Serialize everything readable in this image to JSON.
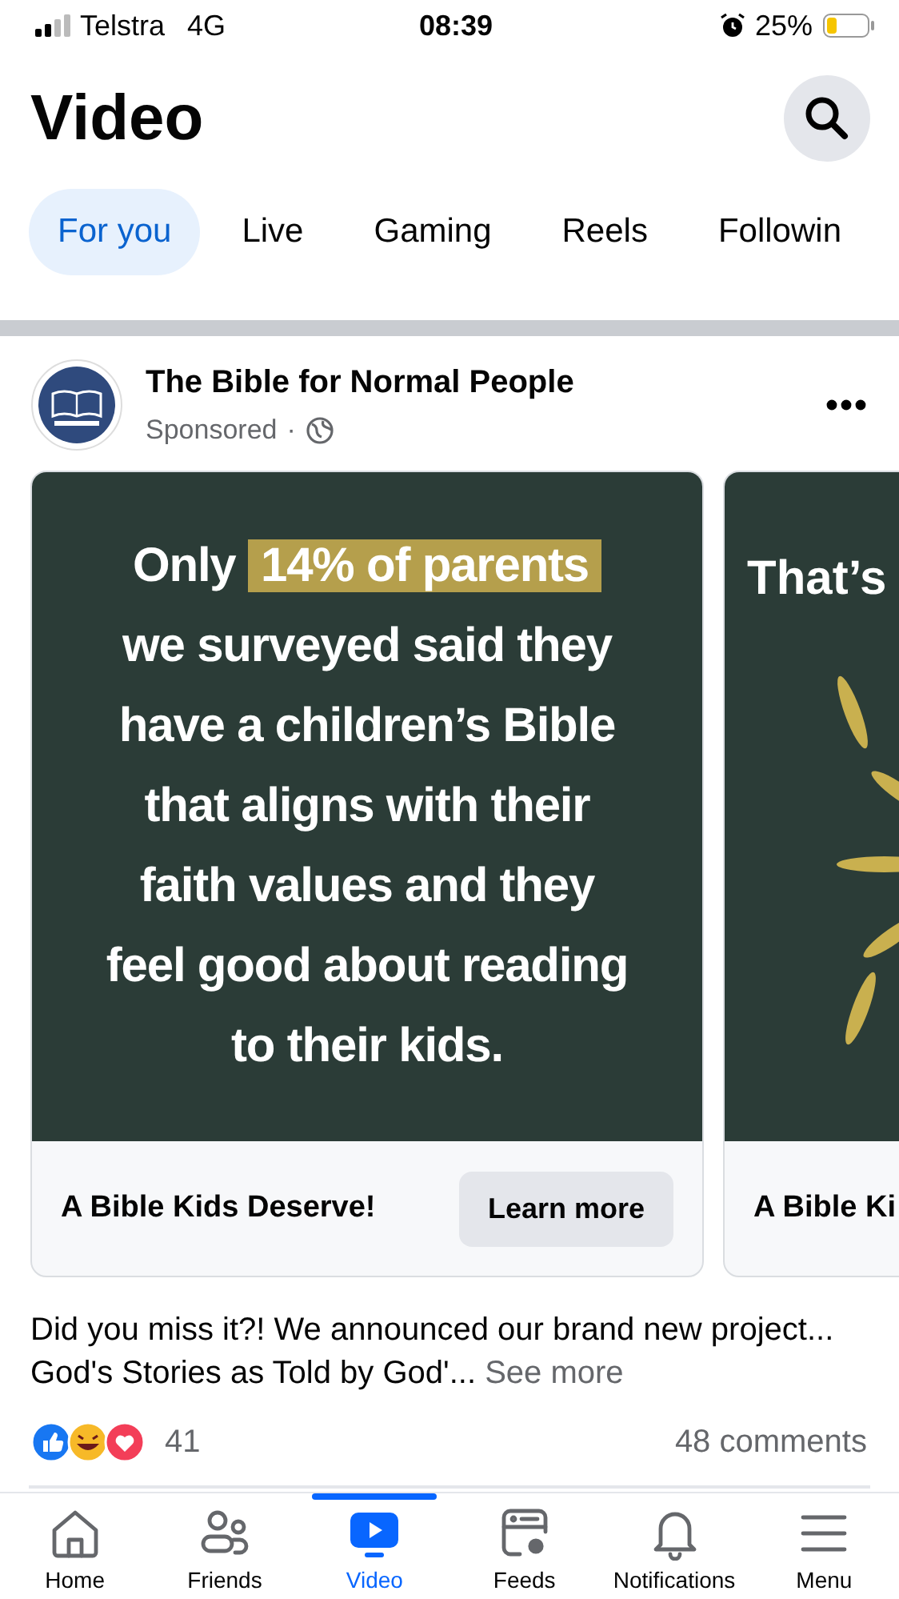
{
  "status_bar": {
    "carrier": "Telstra",
    "network": "4G",
    "time": "08:39",
    "battery": "25%"
  },
  "header": {
    "title": "Video"
  },
  "tabs": [
    {
      "label": "For you",
      "selected": true
    },
    {
      "label": "Live",
      "selected": false
    },
    {
      "label": "Gaming",
      "selected": false
    },
    {
      "label": "Reels",
      "selected": false
    },
    {
      "label": "Followin",
      "selected": false
    }
  ],
  "post": {
    "author": "The Bible for Normal People",
    "meta": "Sponsored",
    "meta_separator": "·",
    "cards": [
      {
        "kind": "statement",
        "headline_before": "Only",
        "headline_highlight": "14% of parents",
        "headline_after": "we surveyed said they have a children’s Bible that aligns with their faith values and they feel good about reading to their kids.",
        "footer_title": "A Bible Kids Deserve!",
        "button": "Learn more"
      },
      {
        "kind": "burst",
        "headline_before": "That’s",
        "footer_title": "A Bible Ki"
      }
    ],
    "caption": "Did you miss it?! We announced our brand new project... God's Stories as Told by God'...",
    "see_more": "See more",
    "reaction_count": "41",
    "comments": "48 comments"
  },
  "nav": [
    {
      "label": "Home",
      "kind": "home",
      "selected": false
    },
    {
      "label": "Friends",
      "kind": "friends",
      "selected": false
    },
    {
      "label": "Video",
      "kind": "video",
      "selected": true
    },
    {
      "label": "Feeds",
      "kind": "feeds",
      "selected": false
    },
    {
      "label": "Notifications",
      "kind": "bell",
      "selected": false
    },
    {
      "label": "Menu",
      "kind": "menu",
      "selected": false
    }
  ]
}
